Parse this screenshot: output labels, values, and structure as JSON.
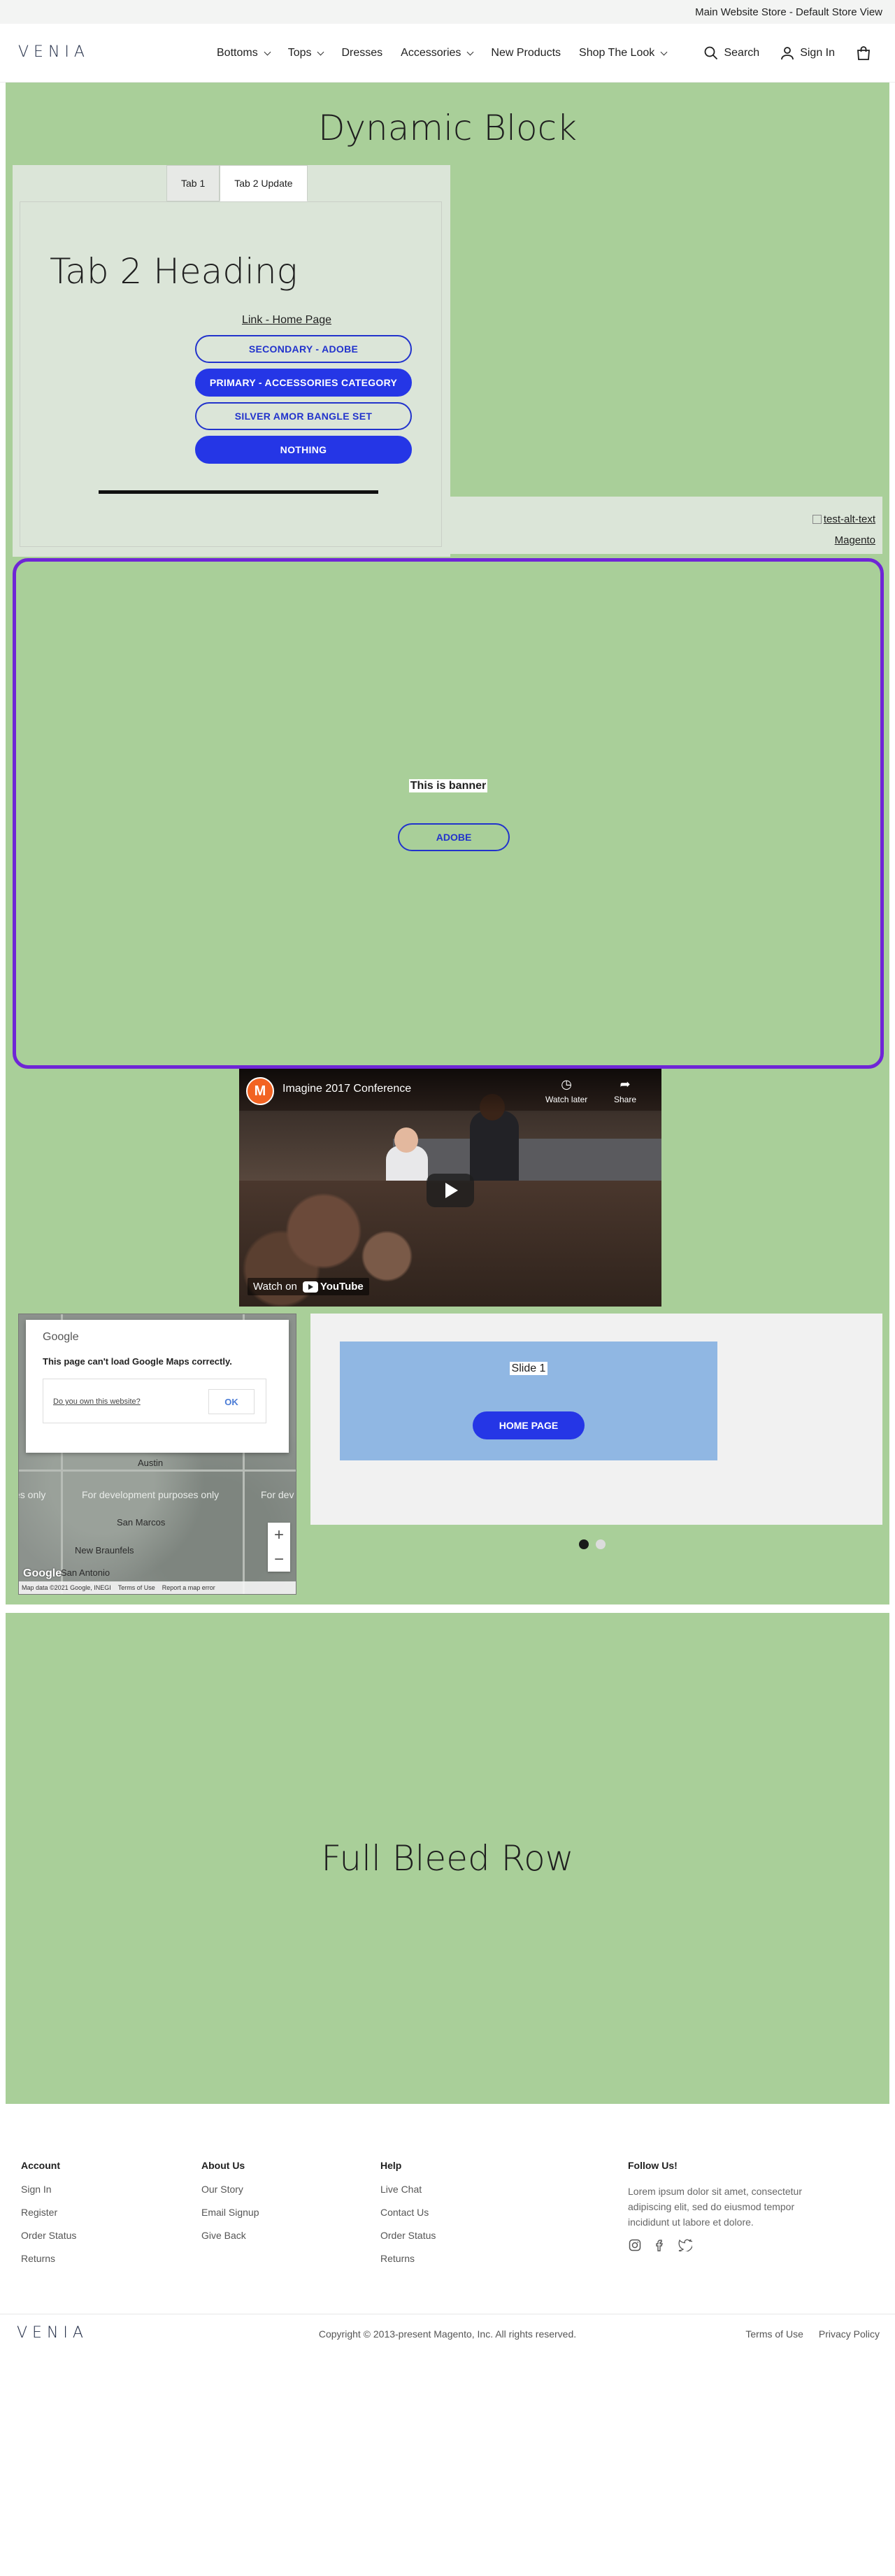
{
  "store_switcher": "Main Website Store - Default Store View",
  "header": {
    "logo": "VENIA",
    "nav": [
      {
        "label": "Bottoms",
        "has_menu": true
      },
      {
        "label": "Tops",
        "has_menu": true
      },
      {
        "label": "Dresses",
        "has_menu": false
      },
      {
        "label": "Accessories",
        "has_menu": true
      },
      {
        "label": "New Products",
        "has_menu": false
      },
      {
        "label": "Shop The Look",
        "has_menu": true
      }
    ],
    "search_label": "Search",
    "signin_label": "Sign In",
    "cart_icon": "shopping-bag-icon"
  },
  "dynamic_block": {
    "title": "Dynamic Block",
    "background": "#a9cf99",
    "tabs": [
      "Tab 1",
      "Tab 2 Update"
    ],
    "active_tab": 1,
    "tab_heading": "Tab 2 Heading",
    "tab_link": "Link - Home Page",
    "buttons": [
      {
        "label": "SECONDARY - ADOBE",
        "style": "secondary"
      },
      {
        "label": "PRIMARY - ACCESSORIES CATEGORY",
        "style": "primary"
      },
      {
        "label": "SILVER AMOR BANGLE SET",
        "style": "secondary"
      },
      {
        "label": "NOTHING",
        "style": "primary"
      }
    ],
    "image_alt": "test-alt-text",
    "image_link": "Magento",
    "banner": {
      "text": "This is banner",
      "button": "ADOBE",
      "border_color": "#6f25d6"
    },
    "video": {
      "title": "Imagine 2017 Conference",
      "watch_later": "Watch later",
      "share": "Share",
      "watch_on": "Watch on",
      "youtube": "YouTube"
    },
    "map": {
      "brand": "Google",
      "error": "This page can't load Google Maps correctly.",
      "own_site": "Do you own this website?",
      "ok": "OK",
      "dev_text": "For development purposes only",
      "cities": [
        "Austin",
        "San Marcos",
        "New Braunfels",
        "San Antonio"
      ],
      "attribution": "Map data ©2021 Google, INEGI",
      "terms": "Terms of Use",
      "report": "Report a map error"
    },
    "slider": {
      "slide_title": "Slide 1",
      "slide_button": "HOME PAGE",
      "slide_count": 2,
      "active_slide": 0
    }
  },
  "full_bleed": {
    "title": "Full Bleed Row"
  },
  "footer": {
    "columns": [
      {
        "title": "Account",
        "links": [
          "Sign In",
          "Register",
          "Order Status",
          "Returns"
        ]
      },
      {
        "title": "About Us",
        "links": [
          "Our Story",
          "Email Signup",
          "Give Back"
        ]
      },
      {
        "title": "Help",
        "links": [
          "Live Chat",
          "Contact Us",
          "Order Status",
          "Returns"
        ]
      }
    ],
    "follow_title": "Follow Us!",
    "follow_text": "Lorem ipsum dolor sit amet, consectetur adipiscing elit, sed do eiusmod tempor incididunt ut labore et dolore.",
    "social": [
      "instagram-icon",
      "facebook-icon",
      "twitter-icon"
    ],
    "logo": "VENIA",
    "copyright": "Copyright © 2013-present Magento, Inc. All rights reserved.",
    "legal": [
      "Terms of Use",
      "Privacy Policy"
    ]
  }
}
